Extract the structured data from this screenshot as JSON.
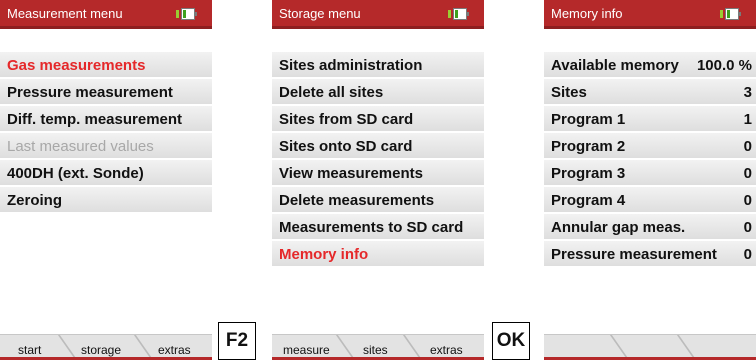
{
  "screen1": {
    "title": "Measurement menu",
    "items": [
      {
        "label": "Gas measurements",
        "state": "active"
      },
      {
        "label": "Pressure measurement",
        "state": "normal"
      },
      {
        "label": "Diff. temp. measurement",
        "state": "normal"
      },
      {
        "label": "Last measured values",
        "state": "disabled"
      },
      {
        "label": "400DH (ext. Sonde)",
        "state": "normal"
      },
      {
        "label": "Zeroing",
        "state": "normal"
      }
    ],
    "softkeys": [
      "start",
      "storage",
      "extras"
    ]
  },
  "key1": "F2",
  "screen2": {
    "title": "Storage menu",
    "items": [
      {
        "label": "Sites administration",
        "state": "normal"
      },
      {
        "label": "Delete all sites",
        "state": "normal"
      },
      {
        "label": "Sites from SD card",
        "state": "normal"
      },
      {
        "label": "Sites onto SD card",
        "state": "normal"
      },
      {
        "label": "View measurements",
        "state": "normal"
      },
      {
        "label": "Delete measurements",
        "state": "normal"
      },
      {
        "label": "Measurements to SD card",
        "state": "normal"
      },
      {
        "label": "Memory info",
        "state": "active"
      }
    ],
    "softkeys": [
      "measure",
      "sites",
      "extras"
    ]
  },
  "key2": "OK",
  "screen3": {
    "title": "Memory info",
    "items": [
      {
        "label": "Available memory",
        "value": "100.0 %"
      },
      {
        "label": "Sites",
        "value": "3"
      },
      {
        "label": "Program 1",
        "value": "1"
      },
      {
        "label": "Program 2",
        "value": "0"
      },
      {
        "label": "Program 3",
        "value": "0"
      },
      {
        "label": "Program 4",
        "value": "0"
      },
      {
        "label": "Annular gap meas.",
        "value": "0"
      },
      {
        "label": "Pressure measurement",
        "value": "0"
      }
    ],
    "softkeys": [
      "",
      "",
      ""
    ]
  },
  "colors": {
    "title_bar": "#b5292a",
    "active_text": "#e5282a",
    "disabled_text": "#a8a8a8"
  }
}
